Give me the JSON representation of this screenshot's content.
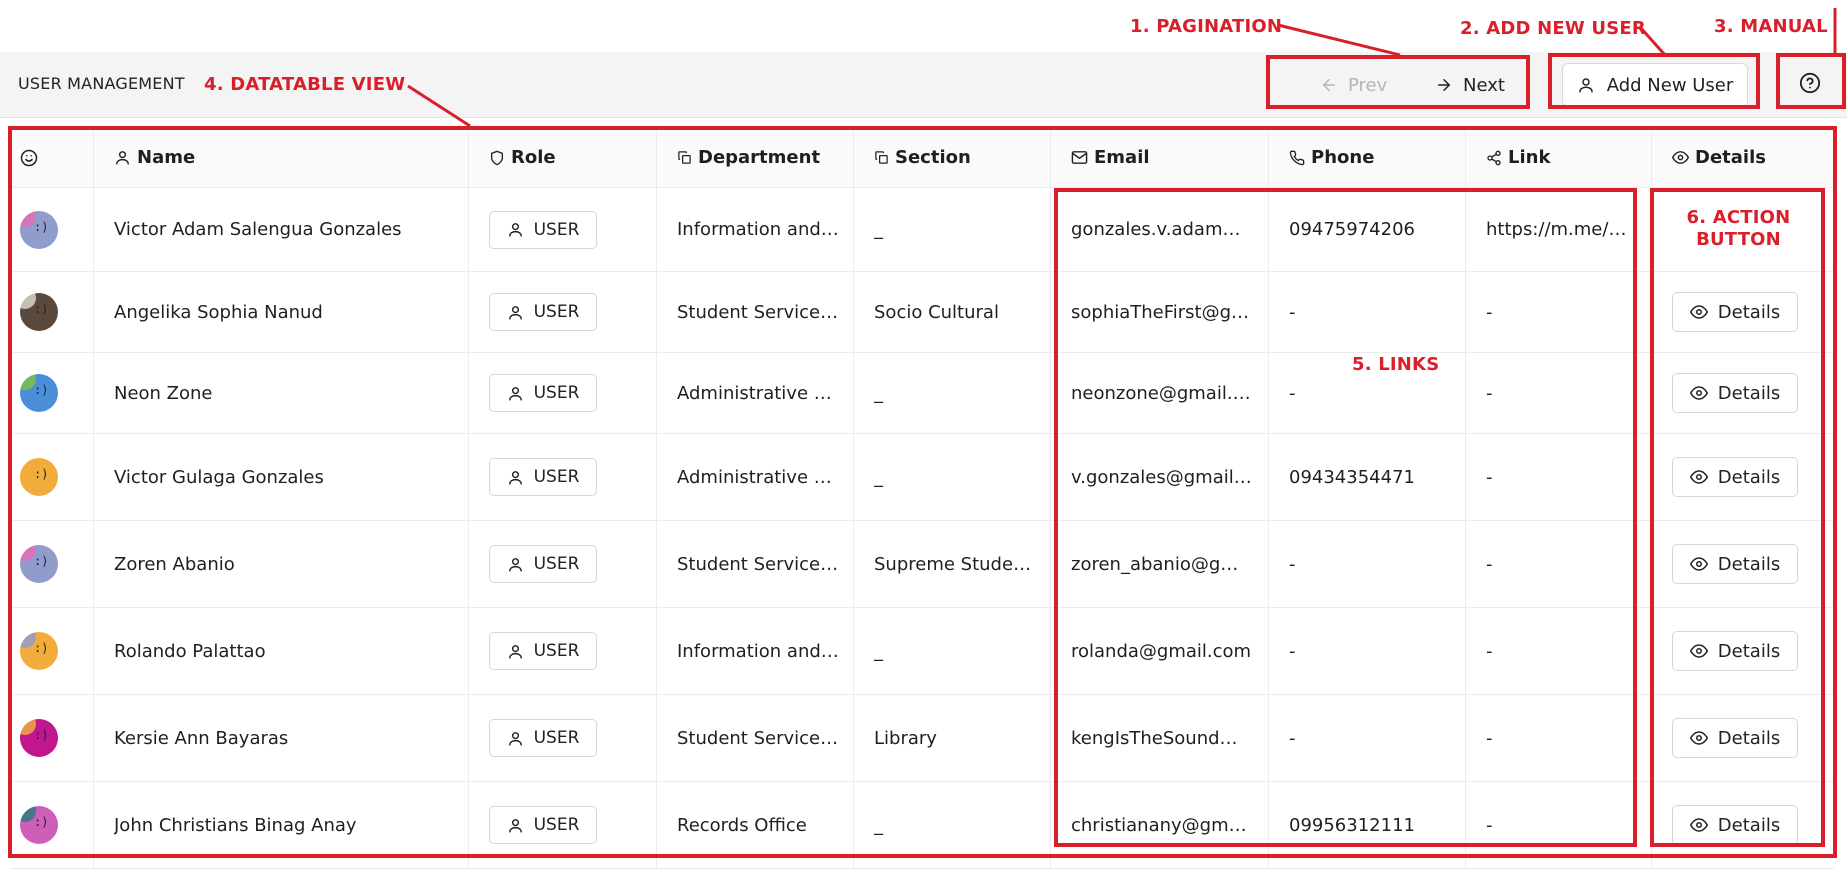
{
  "header": {
    "title": "USER MANAGEMENT",
    "prev_label": "Prev",
    "next_label": "Next",
    "add_user_label": "Add New User",
    "manual_icon": "help-circle-icon"
  },
  "table": {
    "columns": [
      {
        "label": "",
        "icon": "smile-icon"
      },
      {
        "label": "Name",
        "icon": "user-icon"
      },
      {
        "label": "Role",
        "icon": "shield-icon"
      },
      {
        "label": "Department",
        "icon": "copy-icon"
      },
      {
        "label": "Section",
        "icon": "copy-icon"
      },
      {
        "label": "Email",
        "icon": "mail-icon"
      },
      {
        "label": "Phone",
        "icon": "phone-icon"
      },
      {
        "label": "Link",
        "icon": "share-icon"
      },
      {
        "label": "Details",
        "icon": "eye-icon"
      }
    ],
    "rows": [
      {
        "name": "Victor Adam Salengua Gonzales",
        "role": "USER",
        "department": "Information and Communication Technology",
        "section": "_",
        "email": "gonzales.v.adam@gmail.com",
        "phone": "09475974206",
        "link": "https://m.me/victor",
        "details": "",
        "avatar_color": "#8f9ccc",
        "avatar_accent": "#e46fb5"
      },
      {
        "name": "Angelika Sophia Nanud",
        "role": "USER",
        "department": "Student Services Office",
        "section": "Socio Cultural",
        "email": "sophiaTheFirst@gmail.com",
        "phone": "-",
        "link": "-",
        "details": "Details",
        "avatar_color": "#5a4a3e",
        "avatar_accent": "#d9d2c7"
      },
      {
        "name": "Neon Zone",
        "role": "USER",
        "department": "Administrative Services",
        "section": "_",
        "email": "neonzone@gmail.com",
        "phone": "-",
        "link": "-",
        "details": "Details",
        "avatar_color": "#4a8fd8",
        "avatar_accent": "#7cc243"
      },
      {
        "name": "Victor Gulaga Gonzales",
        "role": "USER",
        "department": "Administrative Services",
        "section": "_",
        "email": "v.gonzales@gmail.com",
        "phone": "09434354471",
        "link": "-",
        "details": "Details",
        "avatar_color": "#f2ac3c",
        "avatar_accent": "#f2ac3c"
      },
      {
        "name": "Zoren Abanio",
        "role": "USER",
        "department": "Student Services Office",
        "section": "Supreme Student Council",
        "email": "zoren_abanio@gmail.com",
        "phone": "-",
        "link": "-",
        "details": "Details",
        "avatar_color": "#8f9ccc",
        "avatar_accent": "#e46fb5"
      },
      {
        "name": "Rolando Palattao",
        "role": "USER",
        "department": "Information and Communication Technology",
        "section": "_",
        "email": "rolanda@gmail.com",
        "phone": "-",
        "link": "-",
        "details": "Details",
        "avatar_color": "#f2ac3c",
        "avatar_accent": "#8f9ccc"
      },
      {
        "name": "Kersie Ann Bayaras",
        "role": "USER",
        "department": "Student Services Office",
        "section": "Library",
        "email": "kengIsTheSound@gmail.com",
        "phone": "-",
        "link": "-",
        "details": "Details",
        "avatar_color": "#c0178e",
        "avatar_accent": "#f2ac3c"
      },
      {
        "name": "John Christians Binag Anay",
        "role": "USER",
        "department": "Records Office",
        "section": "_",
        "email": "christianany@gmail.com",
        "phone": "09956312111",
        "link": "-",
        "details": "Details",
        "avatar_color": "#cc5fb8",
        "avatar_accent": "#2f7a83"
      }
    ]
  },
  "annotations": {
    "pagination": "1. PAGINATION",
    "add_new_user": "2. ADD NEW USER",
    "manual": "3. MANUAL",
    "datatable": "4. DATATABLE VIEW",
    "links": "5. LINKS",
    "action_button": "6. ACTION BUTTON",
    "color": "#d9202a"
  }
}
